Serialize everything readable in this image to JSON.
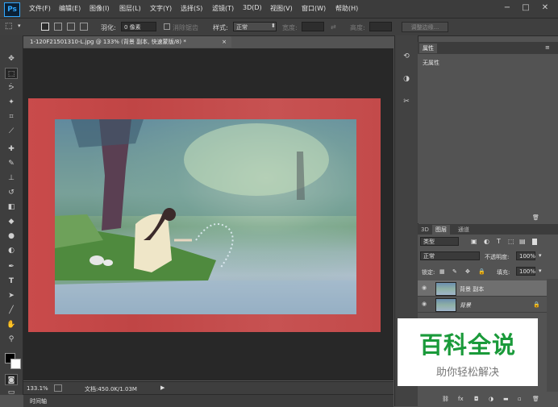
{
  "app": {
    "logo": "Ps"
  },
  "menu": [
    "文件(F)",
    "编辑(E)",
    "图像(I)",
    "图层(L)",
    "文字(Y)",
    "选择(S)",
    "滤镜(T)",
    "3D(D)",
    "视图(V)",
    "窗口(W)",
    "帮助(H)"
  ],
  "window_controls": {
    "minimize": "−",
    "restore": "□",
    "close": "✕"
  },
  "options": {
    "feather_label": "羽化:",
    "feather_value": "0 像素",
    "antialias_label": "消除锯齿",
    "style_label": "样式:",
    "style_value": "正常",
    "width_label": "宽度:",
    "height_label": "高度:",
    "refine_edge_button": "调整边缘..."
  },
  "document": {
    "tab_title": "1-120F21501310-L.jpg @ 133% (背景 副本, 快速蒙版/8) *",
    "tab_close": "×"
  },
  "status": {
    "zoom": "133.1%",
    "doc_info": "文档:450.0K/1.03M"
  },
  "timeline": {
    "label": "时间轴"
  },
  "properties": {
    "tab": "属性",
    "content": "无属性"
  },
  "layers": {
    "tabs": [
      "3D",
      "图层",
      "通道"
    ],
    "filter_kind": "类型",
    "blend_mode": "正常",
    "opacity_label": "不透明度:",
    "opacity_value": "100%",
    "lock_label": "锁定:",
    "fill_label": "填充:",
    "fill_value": "100%",
    "rows": [
      {
        "name": "背景 副本"
      },
      {
        "name": "背景"
      }
    ]
  },
  "watermark": {
    "title": "百科全说",
    "subtitle": "助你轻松解决"
  }
}
